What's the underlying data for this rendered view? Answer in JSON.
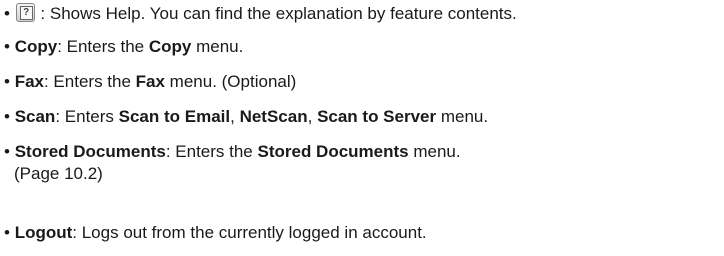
{
  "items": [
    {
      "icon": "help-icon",
      "icon_glyph": "?",
      "text": " : Shows Help. You can find the explanation by feature contents."
    },
    {
      "b1": "Copy",
      "t1": ": Enters the ",
      "b2": "Copy",
      "t2": " menu."
    },
    {
      "b1": "Fax",
      "t1": ": Enters the ",
      "b2": "Fax",
      "t2": " menu. (Optional)"
    },
    {
      "b1": "Scan",
      "t1": ": Enters ",
      "b2": "Scan to Email",
      "t2": ", ",
      "b3": "NetScan",
      "t3": ", ",
      "b4": "Scan to Server",
      "t4": " menu."
    },
    {
      "b1": "Stored Documents",
      "t1": ": Enters the ",
      "b2": "Stored Documents",
      "t2": " menu.",
      "line2": "(Page 10.2)"
    },
    {
      "b1": "Logout",
      "t1": ": Logs out from the currently logged in account."
    }
  ]
}
